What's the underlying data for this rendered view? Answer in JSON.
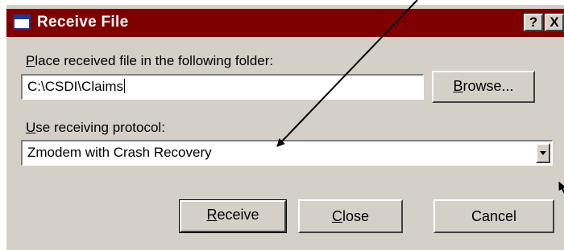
{
  "dialog": {
    "title": "Receive File",
    "help_button": "?",
    "close_button": "X"
  },
  "folder": {
    "label_key": "P",
    "label_rest": "lace received file in the following folder:",
    "value": "C:\\CSDI\\Claims",
    "browse_key": "B",
    "browse_rest": "rowse..."
  },
  "protocol": {
    "label_key": "U",
    "label_rest": "se receiving protocol:",
    "selected": "Zmodem with Crash Recovery"
  },
  "buttons": {
    "receive_key": "R",
    "receive_rest": "eceive",
    "close_key": "C",
    "close_rest": "lose",
    "cancel": "Cancel"
  }
}
